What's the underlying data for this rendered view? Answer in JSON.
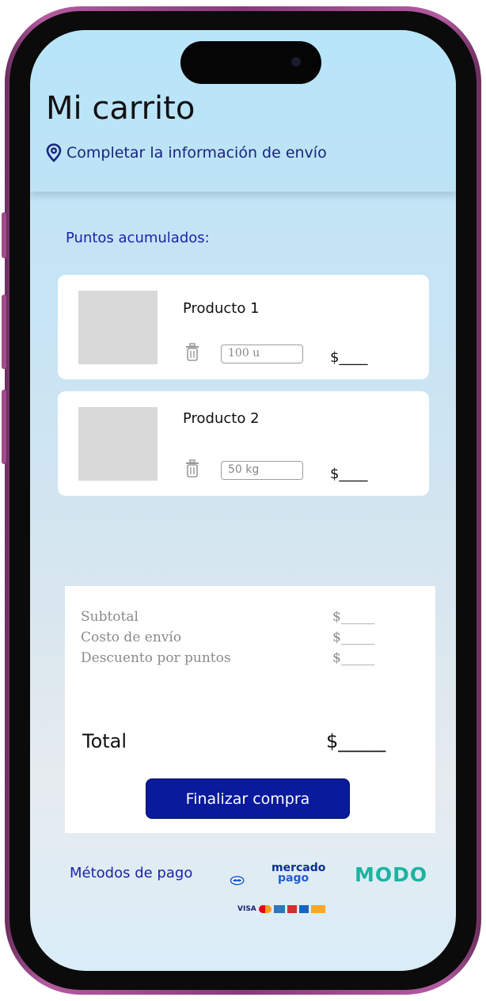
{
  "header": {
    "title": "Mi carrito",
    "shipping_link": "Completar la información de envío"
  },
  "points": {
    "label": "Puntos acumulados:"
  },
  "cart": {
    "items": [
      {
        "name": "Producto 1",
        "quantity": "100 u",
        "price": "$____"
      },
      {
        "name": "Producto 2",
        "quantity": "50 kg",
        "price": "$____"
      }
    ]
  },
  "summary": {
    "subtotal_label": "Subtotal",
    "subtotal_value": "$_____",
    "shipping_label": "Costo de envío",
    "shipping_value": "$_____",
    "discount_label": "Descuento por puntos",
    "discount_value": "$_____",
    "total_label": "Total",
    "total_value": "$_____",
    "finish_button": "Finalizar compra"
  },
  "payment": {
    "label": "Métodos de pago",
    "mp_top": "mercado",
    "mp_bottom": "pago",
    "visa": "VISA",
    "modo": "MODO"
  },
  "colors": {
    "accent": "#0a1a9c",
    "link": "#1a237e",
    "frame": "#a14b8c",
    "modo": "#1bb4a1"
  }
}
